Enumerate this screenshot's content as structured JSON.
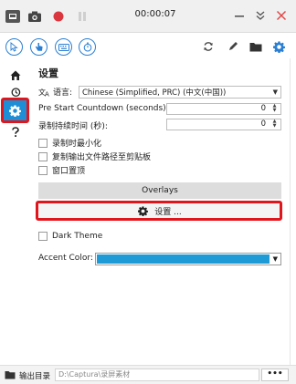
{
  "titlebar": {
    "timer": "00:00:07"
  },
  "settings": {
    "heading": "设置",
    "language_label": "语言:",
    "language_value": "Chinese (Simplified, PRC) (中文(中国))",
    "countdown_label": "Pre Start Countdown (seconds):",
    "countdown_value": "0",
    "duration_label": "录制持续时间 (秒):",
    "duration_value": "0",
    "checkboxes": [
      {
        "label": "录制时最小化"
      },
      {
        "label": "复制输出文件路径至剪贴板"
      },
      {
        "label": "窗口置顶"
      }
    ],
    "overlays_label": "Overlays",
    "settings_button_label": "设置 ...",
    "dark_theme_label": "Dark Theme",
    "accent_label": "Accent Color:",
    "accent_color": "#1e9ad6"
  },
  "footer": {
    "output_label": "输出目录",
    "output_path": "D:\\Captura\\录屏素材",
    "more_label": "•••"
  },
  "colors": {
    "brand_blue": "#2a7fd3",
    "record_red": "#d9363e",
    "highlight_red": "#e0161c",
    "active_blue": "#1e8fd6"
  }
}
